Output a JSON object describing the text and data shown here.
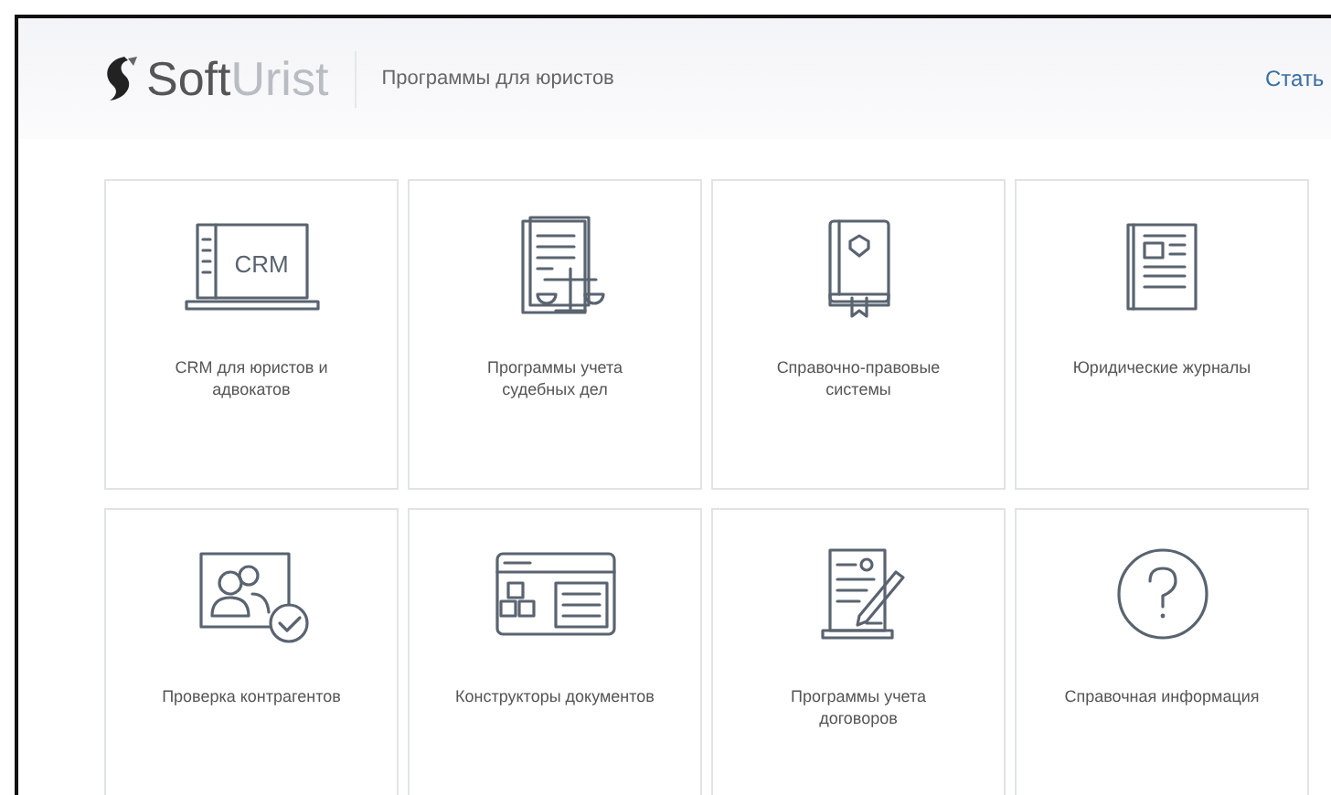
{
  "header": {
    "logo": {
      "part_1": "Soft",
      "part_2": "Urist"
    },
    "tagline": "Программы для юристов",
    "nav_link": "Стать"
  },
  "cards": [
    {
      "label": "CRM для юристов и адвокатов",
      "icon_text": "CRM"
    },
    {
      "label": "Программы учета судебных дел"
    },
    {
      "label": "Справочно-правовые системы"
    },
    {
      "label": "Юридические журналы"
    },
    {
      "label": "Проверка контрагентов"
    },
    {
      "label": "Конструкторы документов"
    },
    {
      "label": "Программы учета договоров"
    },
    {
      "label": "Справочная информация"
    }
  ]
}
